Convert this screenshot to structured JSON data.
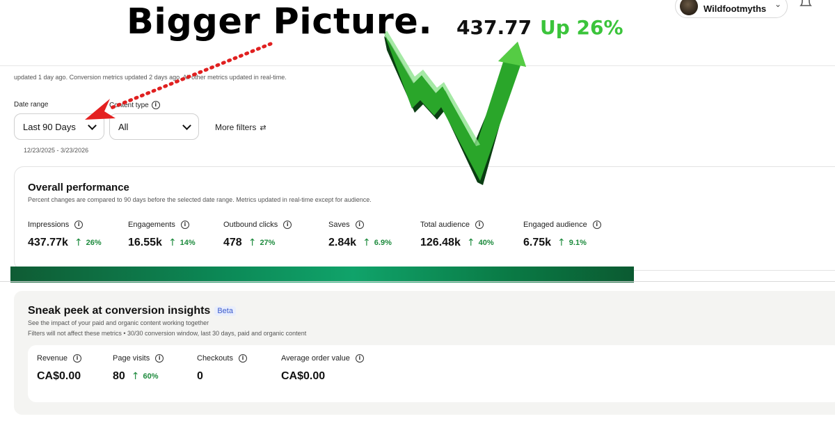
{
  "overlay": {
    "headline": "Bigger Picture.",
    "value": "437.77",
    "change": "Up 26%",
    "accent_color": "#3bc43b"
  },
  "account": {
    "name": "Wildfootmyths"
  },
  "header": {
    "updated_text": "updated 1 day ago. Conversion metrics updated 2 days ago. All other metrics updated in real-time."
  },
  "filters": {
    "date_range_label": "Date range",
    "date_range_value": "Last 90 Days",
    "content_type_label": "Content type",
    "content_type_value": "All",
    "more_filters_label": "More filters",
    "date_span": "12/23/2025 - 3/23/2026"
  },
  "overall": {
    "title": "Overall performance",
    "subtitle": "Percent changes are compared to 90 days before the selected date range. Metrics updated in real-time except for audience.",
    "metrics": [
      {
        "label": "Impressions",
        "value": "437.77k",
        "change": "26%"
      },
      {
        "label": "Engagements",
        "value": "16.55k",
        "change": "14%"
      },
      {
        "label": "Outbound clicks",
        "value": "478",
        "change": "27%"
      },
      {
        "label": "Saves",
        "value": "2.84k",
        "change": "6.9%"
      },
      {
        "label": "Total audience",
        "value": "126.48k",
        "change": "40%"
      },
      {
        "label": "Engaged audience",
        "value": "6.75k",
        "change": "9.1%"
      }
    ]
  },
  "conversion": {
    "title": "Sneak peek at conversion insights",
    "badge": "Beta",
    "subtitle1": "See the impact of your paid and organic content working together",
    "subtitle2": "Filters will not affect these metrics • 30/30 conversion window, last 30 days, paid and organic content",
    "metrics": [
      {
        "label": "Revenue",
        "value": "CA$0.00",
        "change": ""
      },
      {
        "label": "Page visits",
        "value": "80",
        "change": "60%"
      },
      {
        "label": "Checkouts",
        "value": "0",
        "change": ""
      },
      {
        "label": "Average order value",
        "value": "CA$0.00",
        "change": ""
      }
    ]
  },
  "icons": {
    "info": "i",
    "up_arrow": "↑",
    "filter": "⇄"
  }
}
